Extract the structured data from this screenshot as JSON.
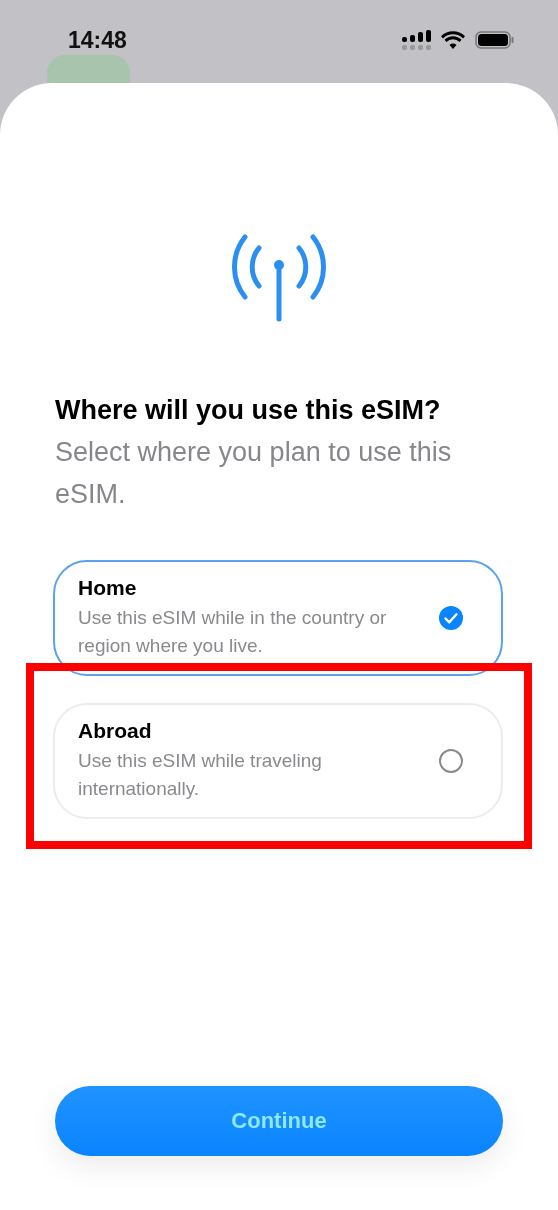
{
  "status_bar": {
    "time": "14:48"
  },
  "heading": {
    "title": "Where will you use this eSIM?",
    "subtitle": "Select where you plan to use this eSIM."
  },
  "options": [
    {
      "title": "Home",
      "description": "Use this eSIM while in the country or region where you live.",
      "selected": true,
      "highlighted": false
    },
    {
      "title": "Abroad",
      "description": "Use this eSIM while traveling internationally.",
      "selected": false,
      "highlighted": true
    }
  ],
  "continue_button": {
    "label": "Continue"
  }
}
